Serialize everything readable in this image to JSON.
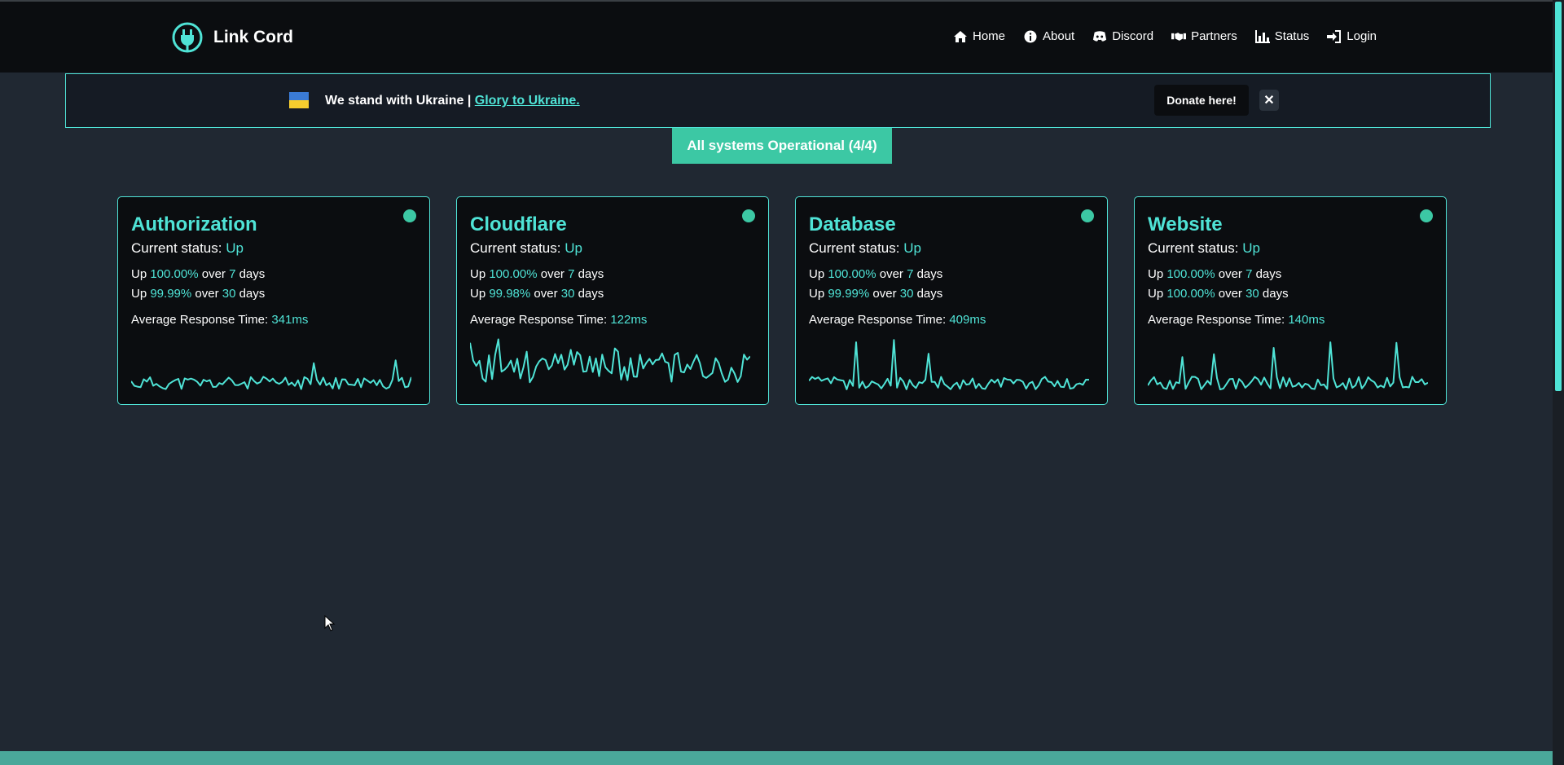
{
  "brand": {
    "name": "Link Cord",
    "icon": "plug-logo-icon"
  },
  "nav": [
    {
      "label": "Home",
      "icon": "home-icon"
    },
    {
      "label": "About",
      "icon": "info-icon"
    },
    {
      "label": "Discord",
      "icon": "discord-icon"
    },
    {
      "label": "Partners",
      "icon": "handshake-icon"
    },
    {
      "label": "Status",
      "icon": "bar-chart-icon"
    },
    {
      "label": "Login",
      "icon": "login-icon"
    }
  ],
  "banner": {
    "text": "We stand with Ukraine | ",
    "link": "Glory to Ukraine.",
    "donate": "Donate here!",
    "close": "✕"
  },
  "overall_status": "All systems Operational (4/4)",
  "services": [
    {
      "name": "Authorization",
      "status_label": "Current status: ",
      "status": "Up",
      "up7_prefix": "Up ",
      "up7": "100.00%",
      "up7_mid": " over ",
      "up7_days": "7",
      "up7_suffix": " days",
      "up30_prefix": "Up ",
      "up30": "99.99%",
      "up30_mid": " over ",
      "up30_days": "30",
      "up30_suffix": " days",
      "resp_label": "Average Response Time: ",
      "resp": "341ms"
    },
    {
      "name": "Cloudflare",
      "status_label": "Current status: ",
      "status": "Up",
      "up7_prefix": "Up ",
      "up7": "100.00%",
      "up7_mid": " over ",
      "up7_days": "7",
      "up7_suffix": " days",
      "up30_prefix": "Up ",
      "up30": "99.98%",
      "up30_mid": " over ",
      "up30_days": "30",
      "up30_suffix": " days",
      "resp_label": "Average Response Time: ",
      "resp": "122ms"
    },
    {
      "name": "Database",
      "status_label": "Current status: ",
      "status": "Up",
      "up7_prefix": "Up ",
      "up7": "100.00%",
      "up7_mid": " over ",
      "up7_days": "7",
      "up7_suffix": " days",
      "up30_prefix": "Up ",
      "up30": "99.99%",
      "up30_mid": " over ",
      "up30_days": "30",
      "up30_suffix": " days",
      "resp_label": "Average Response Time: ",
      "resp": "409ms"
    },
    {
      "name": "Website",
      "status_label": "Current status: ",
      "status": "Up",
      "up7_prefix": "Up ",
      "up7": "100.00%",
      "up7_mid": " over ",
      "up7_days": "7",
      "up7_suffix": " days",
      "up30_prefix": "Up ",
      "up30": "100.00%",
      "up30_mid": " over ",
      "up30_days": "30",
      "up30_suffix": " days",
      "resp_label": "Average Response Time: ",
      "resp": "140ms"
    }
  ],
  "colors": {
    "accent": "#4fe3d6",
    "status_green": "#3cc8a4",
    "background": "#202832",
    "panel": "#0b0d10"
  }
}
